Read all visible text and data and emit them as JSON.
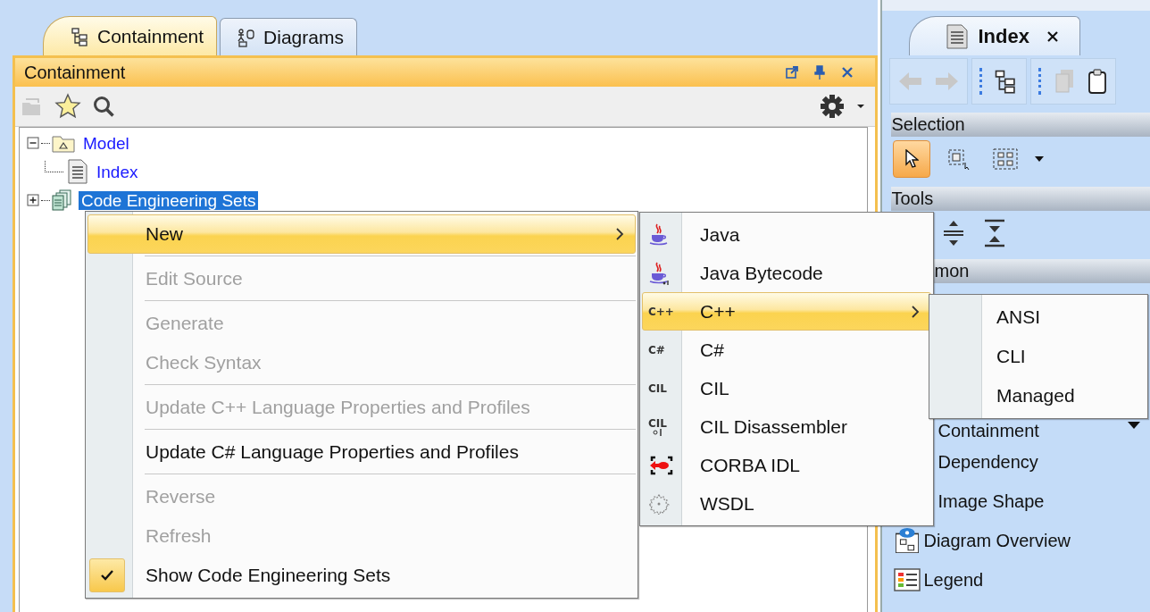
{
  "left_panel": {
    "tabs": [
      {
        "label": "Containment",
        "selected": true
      },
      {
        "label": "Diagrams",
        "selected": false
      }
    ],
    "title": "Containment",
    "tree": [
      {
        "label": "Model",
        "expanded": true,
        "selected": false,
        "children": [
          {
            "label": "Index",
            "selected": false
          }
        ]
      },
      {
        "label": "Code Engineering Sets",
        "expanded": false,
        "selected": true
      }
    ]
  },
  "right_panel": {
    "tab": {
      "label": "Index"
    },
    "selection": {
      "title": "Selection",
      "tools": [
        {
          "kind": "pointer",
          "selected": true
        },
        {
          "kind": "marquee",
          "selected": false
        },
        {
          "kind": "group",
          "selected": false
        }
      ]
    },
    "tools": {
      "title": "Tools"
    },
    "common": {
      "title": "mon"
    },
    "items": [
      {
        "label": "Containment",
        "kind": "covered",
        "dropdown": true
      },
      {
        "label": "Dependency",
        "kind": "covered",
        "dropdown": false
      },
      {
        "label": "Image Shape",
        "kind": "covered",
        "dropdown": false
      },
      {
        "label": "Diagram Overview",
        "kind": "overview",
        "dropdown": false
      },
      {
        "label": "Legend",
        "kind": "legend",
        "dropdown": false
      }
    ]
  },
  "context_menu": {
    "groups": [
      [
        {
          "label": "New",
          "selected": true,
          "disabled": false,
          "checked": false,
          "submenu": true
        }
      ],
      [
        {
          "label": "Edit Source",
          "selected": false,
          "disabled": true,
          "checked": false,
          "submenu": false
        }
      ],
      [
        {
          "label": "Generate",
          "selected": false,
          "disabled": true,
          "checked": false,
          "submenu": false
        },
        {
          "label": "Check Syntax",
          "selected": false,
          "disabled": true,
          "checked": false,
          "submenu": false
        }
      ],
      [
        {
          "label": "Update C++ Language Properties and Profiles",
          "selected": false,
          "disabled": true,
          "checked": false,
          "submenu": false
        }
      ],
      [
        {
          "label": "Update C# Language Properties and Profiles",
          "selected": false,
          "disabled": false,
          "checked": false,
          "submenu": false
        }
      ],
      [
        {
          "label": "Reverse",
          "selected": false,
          "disabled": true,
          "checked": false,
          "submenu": false
        },
        {
          "label": "Refresh",
          "selected": false,
          "disabled": true,
          "checked": false,
          "submenu": false
        },
        {
          "label": "Show Code Engineering Sets",
          "selected": false,
          "disabled": false,
          "checked": true,
          "submenu": false
        }
      ]
    ]
  },
  "new_submenu": {
    "items": [
      {
        "label": "Java",
        "kind": "java",
        "selected": false,
        "submenu": false
      },
      {
        "label": "Java Bytecode",
        "kind": "bytecode",
        "selected": false,
        "submenu": false
      },
      {
        "label": "C++",
        "kind": "text",
        "icon_text": "C++",
        "selected": true,
        "submenu": true
      },
      {
        "label": "C#",
        "kind": "text",
        "icon_text": "C#",
        "selected": false,
        "submenu": false
      },
      {
        "label": "CIL",
        "kind": "text",
        "icon_text": "CIL",
        "selected": false,
        "submenu": false
      },
      {
        "label": "CIL Disassembler",
        "kind": "disasm",
        "icon_text": "CIL",
        "selected": false,
        "submenu": false
      },
      {
        "label": "CORBA IDL",
        "kind": "corba",
        "selected": false,
        "submenu": false
      },
      {
        "label": "WSDL",
        "kind": "wsdl",
        "selected": false,
        "submenu": false
      }
    ]
  },
  "cpp_submenu": {
    "items": [
      {
        "label": "ANSI",
        "selected": false
      },
      {
        "label": "CLI",
        "selected": false
      },
      {
        "label": "Managed",
        "selected": false
      }
    ]
  }
}
